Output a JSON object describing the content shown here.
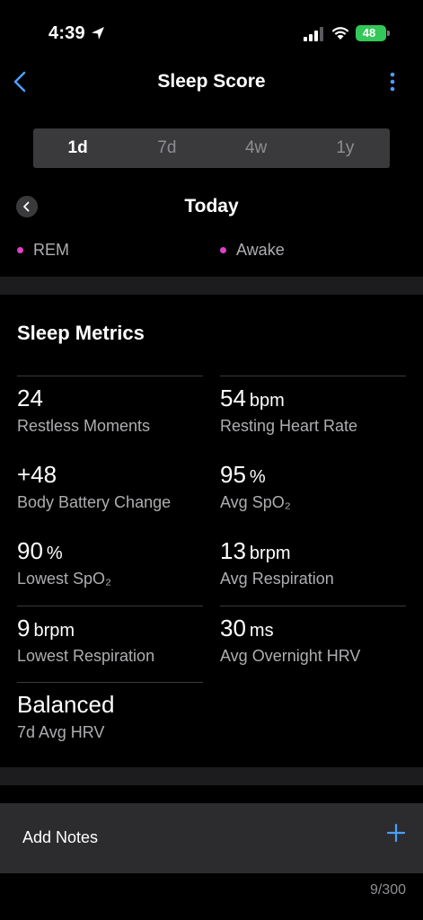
{
  "status_bar": {
    "time": "4:39",
    "battery": "48"
  },
  "header": {
    "title": "Sleep Score"
  },
  "segments": [
    "1d",
    "7d",
    "4w",
    "1y"
  ],
  "date": {
    "label": "Today"
  },
  "legend": [
    {
      "label": "REM",
      "color": "#e040c8"
    },
    {
      "label": "Awake",
      "color": "#e040c8"
    }
  ],
  "metrics_section": {
    "title": "Sleep Metrics",
    "items": [
      {
        "value": "24",
        "unit": "",
        "label": "Restless Moments"
      },
      {
        "value": "54",
        "unit": "bpm",
        "label": "Resting Heart Rate"
      },
      {
        "value": "+48",
        "unit": "",
        "label": "Body Battery Change"
      },
      {
        "value": "95",
        "unit": "%",
        "label": "Avg SpO₂"
      },
      {
        "value": "90",
        "unit": "%",
        "label": "Lowest SpO₂"
      },
      {
        "value": "13",
        "unit": "brpm",
        "label": "Avg Respiration"
      },
      {
        "value": "9",
        "unit": "brpm",
        "label": "Lowest Respiration"
      },
      {
        "value": "30",
        "unit": "ms",
        "label": "Avg Overnight HRV"
      },
      {
        "value": "Balanced",
        "unit": "",
        "label": "7d Avg HRV"
      }
    ]
  },
  "notes": {
    "label": "Add Notes",
    "count": "9/300"
  },
  "colors": {
    "accent": "#4a9eff",
    "background": "#000000",
    "card": "#2c2c2e"
  }
}
